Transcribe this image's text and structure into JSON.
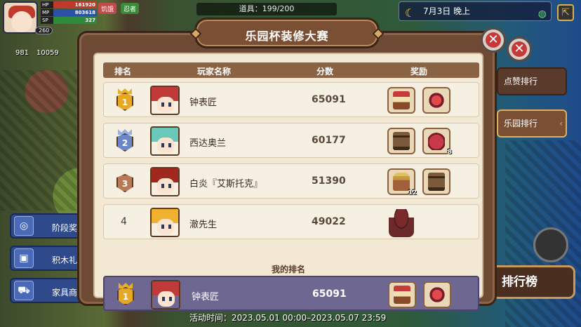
{
  "hud": {
    "hp": "161920",
    "mp": "803618",
    "sp": "327",
    "hp_label": "HP",
    "mp_label": "MP",
    "sp_label": "SP",
    "level": "260",
    "res1": "981",
    "res2": "10059",
    "status1": "饥饿",
    "status2": "忍者",
    "props": "道具：199/200",
    "date": "7月3日 晚上"
  },
  "side_menu": [
    {
      "label": "阶段奖"
    },
    {
      "label": "积木礼"
    },
    {
      "label": "家具商"
    }
  ],
  "right_tabs": {
    "likes": "点赞排行",
    "park": "乐园排行",
    "board": "排行榜"
  },
  "modal": {
    "title": "乐园杯装修大赛",
    "headers": {
      "rank": "排名",
      "player": "玩家名称",
      "score": "分数",
      "reward": "奖励"
    },
    "my_rank_label": "我的排名"
  },
  "rows": [
    {
      "rank": "1",
      "name": "钟表匠",
      "score": "65091",
      "rewards": [
        {
          "icon": "slot-machine",
          "count": ""
        },
        {
          "icon": "red-gem-stand",
          "count": ""
        }
      ]
    },
    {
      "rank": "2",
      "name": "西达奥兰",
      "score": "60177",
      "rewards": [
        {
          "icon": "wood-chair",
          "count": ""
        },
        {
          "icon": "meat-chunk",
          "count": "8"
        }
      ]
    },
    {
      "rank": "3",
      "name": "白炎『艾斯托克』",
      "score": "51390",
      "rewards": [
        {
          "icon": "potion-bottle",
          "count": "12"
        },
        {
          "icon": "wood-chair",
          "count": ""
        }
      ]
    },
    {
      "rank": "4",
      "name": "澈先生",
      "score": "49022",
      "rewards": [
        {
          "icon": "cake-stand",
          "count": ""
        }
      ]
    }
  ],
  "mine": {
    "rank": "1",
    "name": "钟表匠",
    "score": "65091",
    "rewards": [
      {
        "icon": "slot-machine"
      },
      {
        "icon": "red-gem-stand"
      }
    ]
  },
  "footer": {
    "time": "活动时间：2023.05.01 00:00–2023.05.07 23:59"
  },
  "colors": {
    "gold": "#e8a824",
    "silver": "#6a88c8",
    "bronze": "#b87a56",
    "mine_row": "#6e6792",
    "frame": "#6e4a34"
  }
}
